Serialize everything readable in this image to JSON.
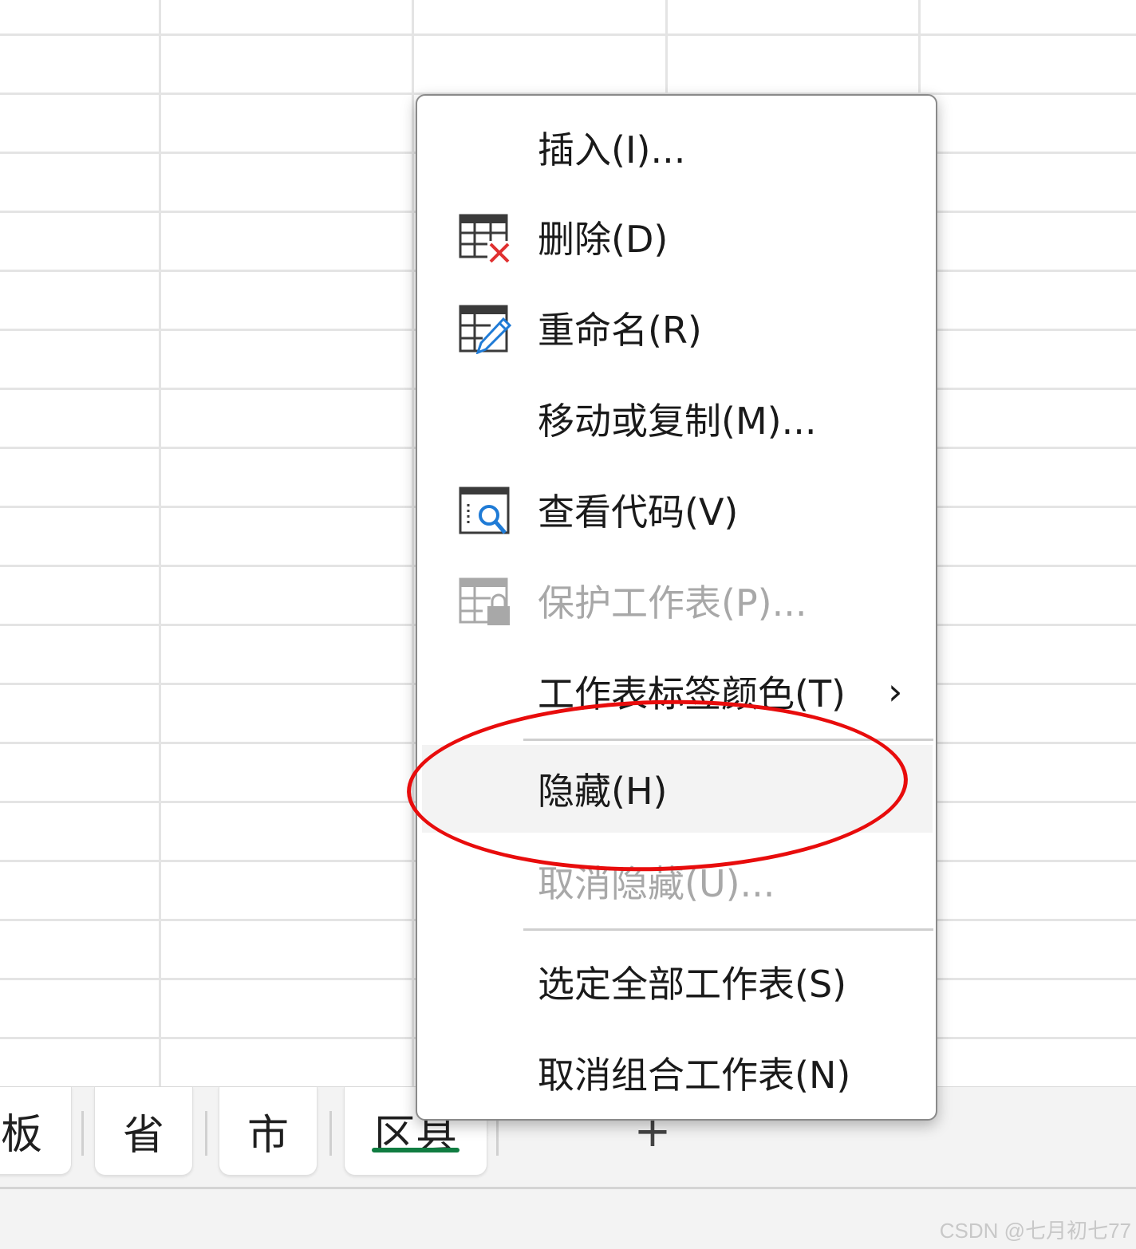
{
  "menu": {
    "items": [
      {
        "label": "插入(I)...",
        "icon": "none",
        "disabled": false
      },
      {
        "label": "删除(D)",
        "icon": "delete-sheet-icon",
        "disabled": false
      },
      {
        "label": "重命名(R)",
        "icon": "rename-sheet-icon",
        "disabled": false
      },
      {
        "label": "移动或复制(M)...",
        "icon": "none",
        "disabled": false
      },
      {
        "label": "查看代码(V)",
        "icon": "view-code-icon",
        "disabled": false
      },
      {
        "label": "保护工作表(P)...",
        "icon": "protect-sheet-icon",
        "disabled": true
      },
      {
        "label": "工作表标签颜色(T)",
        "icon": "none",
        "disabled": false,
        "submenu_arrow": "›"
      },
      {
        "label": "隐藏(H)",
        "icon": "none",
        "disabled": false,
        "hovered": true
      },
      {
        "label": "取消隐藏(U)...",
        "icon": "none",
        "disabled": true
      },
      {
        "label": "选定全部工作表(S)",
        "icon": "none",
        "disabled": false
      },
      {
        "label": "取消组合工作表(N)",
        "icon": "none",
        "disabled": false
      }
    ]
  },
  "sheet_tabs": {
    "tabs": [
      {
        "label": "板",
        "active": false
      },
      {
        "label": "省",
        "active": false
      },
      {
        "label": "市",
        "active": false
      },
      {
        "label": "区县",
        "active": true
      }
    ],
    "add_label": "+"
  },
  "watermark": "CSDN @七月初七77",
  "colors": {
    "annotation": "#e80c0c",
    "active_tab_underline": "#107c41",
    "delete_x": "#e03030",
    "accent_blue": "#1f7bd6"
  }
}
